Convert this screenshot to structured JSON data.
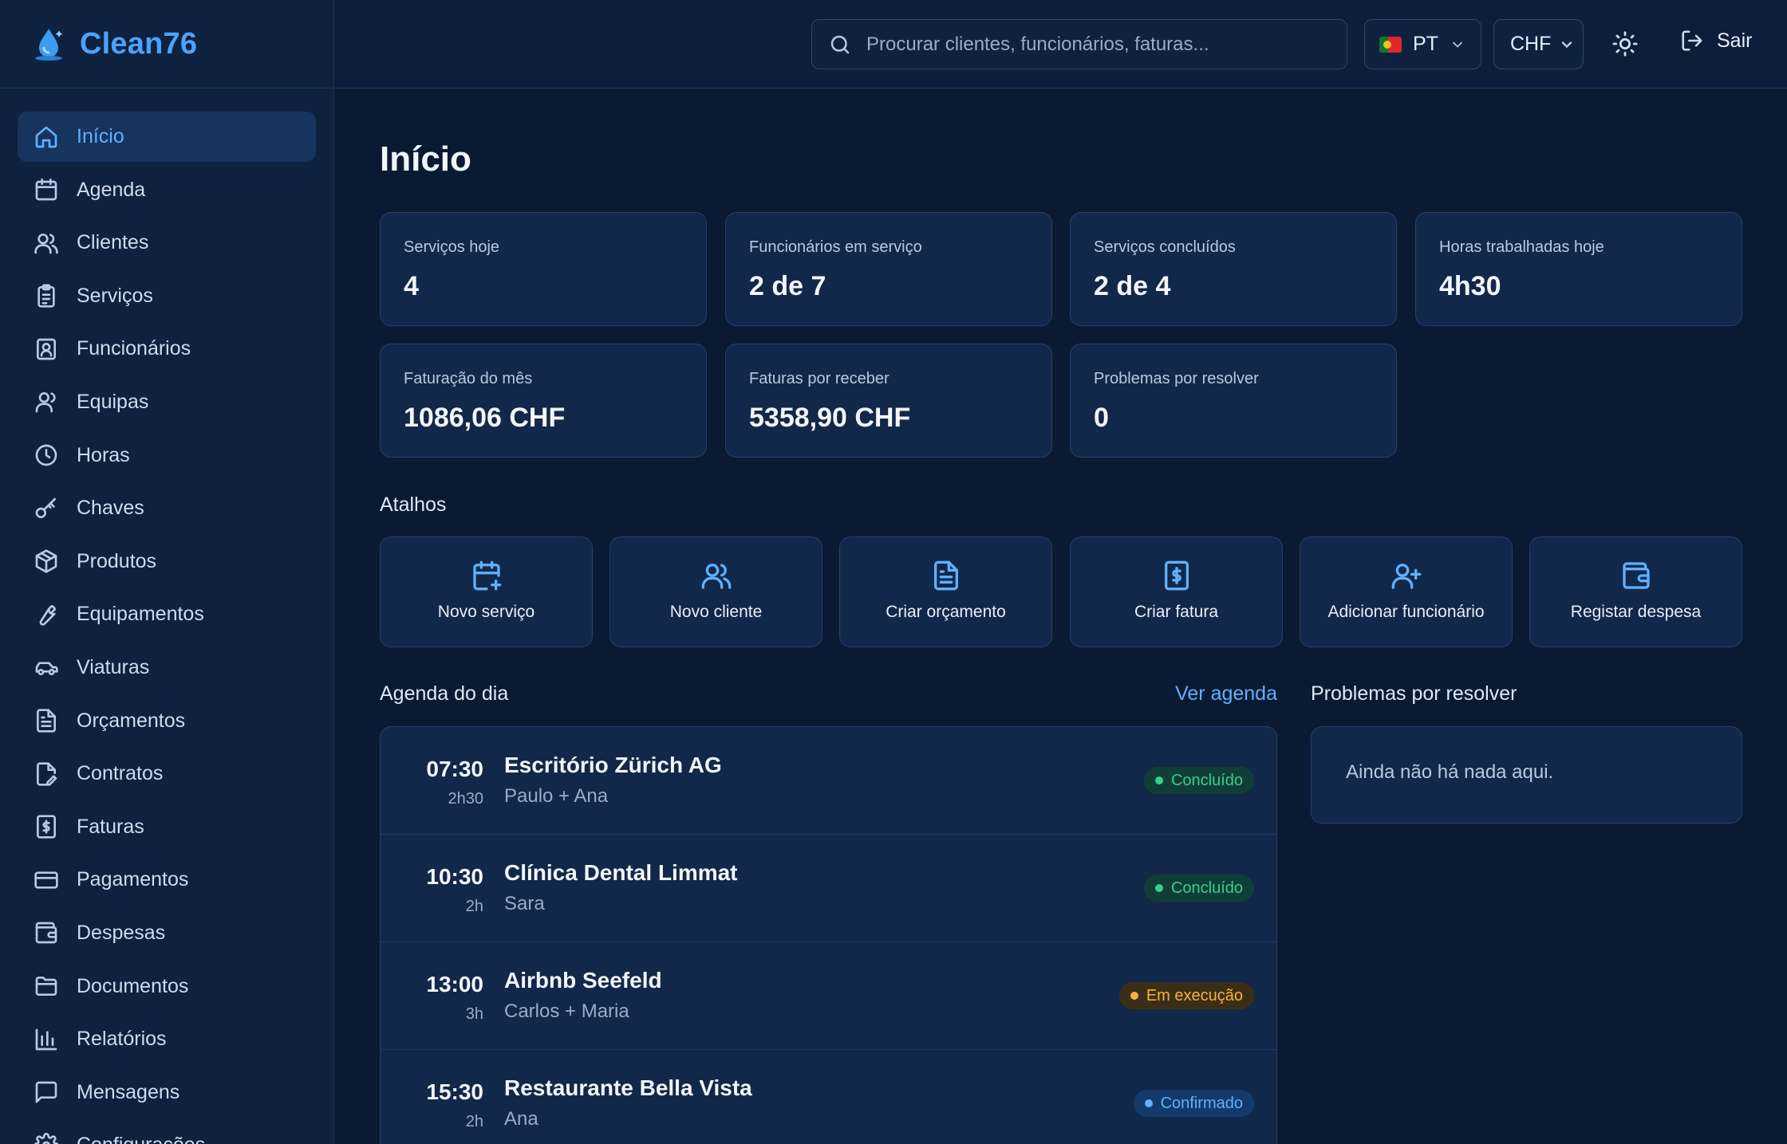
{
  "app": {
    "name": "Clean76"
  },
  "sidebar": {
    "items": [
      {
        "label": "Início",
        "icon": "home-icon",
        "active": true
      },
      {
        "label": "Agenda",
        "icon": "calendar-icon"
      },
      {
        "label": "Clientes",
        "icon": "users-icon"
      },
      {
        "label": "Serviços",
        "icon": "clipboard-icon"
      },
      {
        "label": "Funcionários",
        "icon": "id-badge-icon"
      },
      {
        "label": "Equipas",
        "icon": "team-icon"
      },
      {
        "label": "Horas",
        "icon": "clock-icon"
      },
      {
        "label": "Chaves",
        "icon": "key-icon"
      },
      {
        "label": "Produtos",
        "icon": "package-icon"
      },
      {
        "label": "Equipamentos",
        "icon": "wrench-icon"
      },
      {
        "label": "Viaturas",
        "icon": "car-icon"
      },
      {
        "label": "Orçamentos",
        "icon": "document-icon"
      },
      {
        "label": "Contratos",
        "icon": "contract-icon"
      },
      {
        "label": "Faturas",
        "icon": "invoice-icon"
      },
      {
        "label": "Pagamentos",
        "icon": "credit-card-icon"
      },
      {
        "label": "Despesas",
        "icon": "wallet-icon"
      },
      {
        "label": "Documentos",
        "icon": "folder-icon"
      },
      {
        "label": "Relatórios",
        "icon": "bar-chart-icon"
      },
      {
        "label": "Mensagens",
        "icon": "message-icon"
      },
      {
        "label": "Configurações",
        "icon": "gear-icon"
      }
    ]
  },
  "topbar": {
    "search_placeholder": "Procurar clientes, funcionários, faturas...",
    "language": "PT",
    "currency": "CHF",
    "logout_label": "Sair"
  },
  "page": {
    "title": "Início"
  },
  "stats": [
    {
      "label": "Serviços hoje",
      "value": "4"
    },
    {
      "label": "Funcionários em serviço",
      "value": "2 de 7"
    },
    {
      "label": "Serviços concluídos",
      "value": "2 de 4"
    },
    {
      "label": "Horas trabalhadas hoje",
      "value": "4h30"
    },
    {
      "label": "Faturação do mês",
      "value": "1086,06 CHF"
    },
    {
      "label": "Faturas por receber",
      "value": "5358,90 CHF"
    },
    {
      "label": "Problemas por resolver",
      "value": "0"
    }
  ],
  "shortcuts": {
    "title": "Atalhos",
    "items": [
      {
        "label": "Novo serviço",
        "icon": "calendar-plus-icon"
      },
      {
        "label": "Novo cliente",
        "icon": "users-icon"
      },
      {
        "label": "Criar orçamento",
        "icon": "document-icon"
      },
      {
        "label": "Criar fatura",
        "icon": "invoice-icon"
      },
      {
        "label": "Adicionar funcionário",
        "icon": "user-plus-icon"
      },
      {
        "label": "Registar despesa",
        "icon": "wallet-icon"
      }
    ]
  },
  "agenda": {
    "title": "Agenda do dia",
    "link": "Ver agenda",
    "rows": [
      {
        "time": "07:30",
        "duration": "2h30",
        "client": "Escritório Zürich AG",
        "team": "Paulo + Ana",
        "status": "Concluído",
        "status_kind": "done"
      },
      {
        "time": "10:30",
        "duration": "2h",
        "client": "Clínica Dental Limmat",
        "team": "Sara",
        "status": "Concluído",
        "status_kind": "done"
      },
      {
        "time": "13:00",
        "duration": "3h",
        "client": "Airbnb Seefeld",
        "team": "Carlos + Maria",
        "status": "Em execução",
        "status_kind": "run"
      },
      {
        "time": "15:30",
        "duration": "2h",
        "client": "Restaurante Bella Vista",
        "team": "Ana",
        "status": "Confirmado",
        "status_kind": "conf"
      }
    ]
  },
  "problems": {
    "title": "Problemas por resolver",
    "empty_text": "Ainda não há nada aqui."
  },
  "colors": {
    "background": "#0b1a33",
    "sidebar": "#0e213f",
    "accent": "#5fb0ff",
    "success": "#35d08a",
    "warning": "#f6b23a"
  }
}
